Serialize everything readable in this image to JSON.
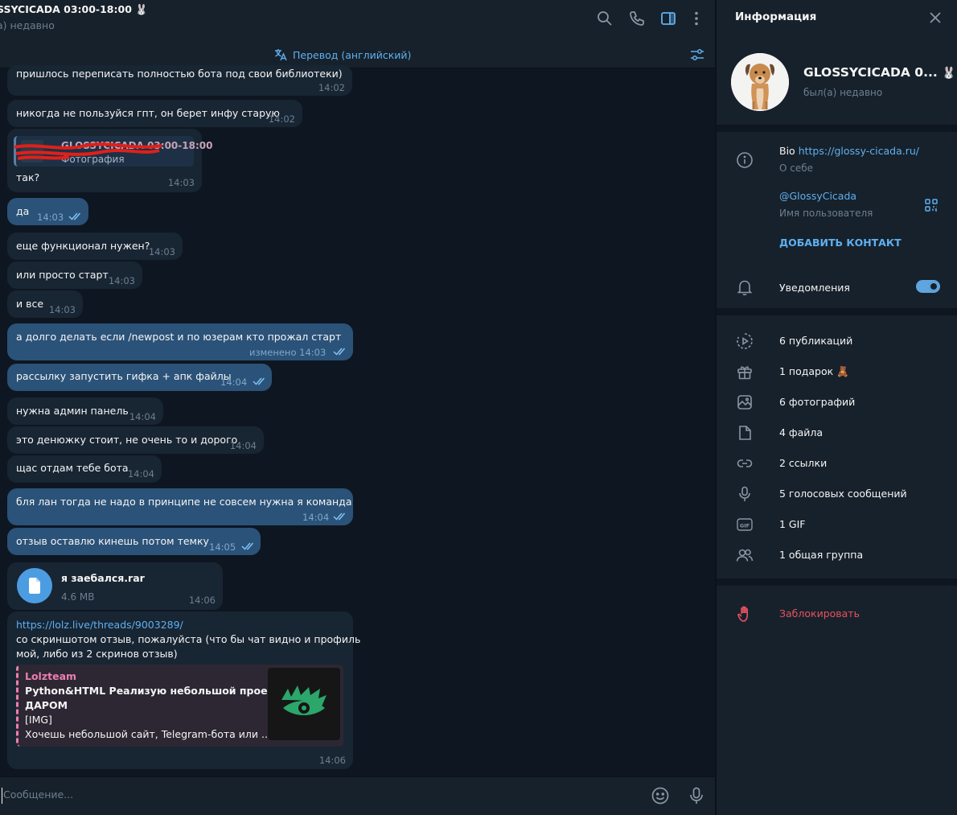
{
  "chat": {
    "title": "SSYCICADA 03:00-18:00",
    "title_emoji": "🐰",
    "status": "а) недавно",
    "translate_label": "Перевод (английский)",
    "messages": [
      {
        "text": "пришлось переписать полностью бота под свои библиотеки)",
        "time": "14:02"
      },
      {
        "text": "никогда не пользуйся гпт, он берет инфу старую",
        "time": "14:02"
      },
      {
        "reply_name": "GLOSSYCICADA 03:00-18:00",
        "reply_text": "Фотография",
        "text": "так?",
        "time": "14:03"
      },
      {
        "text": "да",
        "time": "14:03"
      },
      {
        "text": "еще функционал нужен?",
        "time": "14:03"
      },
      {
        "text": "или просто старт",
        "time": "14:03"
      },
      {
        "text": "и все",
        "time": "14:03"
      },
      {
        "text": "а долго делать если /newpost и по юзерам кто прожал старт",
        "time": "изменено 14:03"
      },
      {
        "text": "рассылку запустить гифка + апк файлы",
        "time": "14:04"
      },
      {
        "text": "нужна админ панель",
        "time": "14:04"
      },
      {
        "text": "это денюжку стоит, не очень то и дорого",
        "time": "14:04"
      },
      {
        "text": "щас отдам тебе бота",
        "time": "14:04"
      },
      {
        "text": "бля лан тогда не надо в принципе не совсем нужна я команда",
        "time": "14:04"
      },
      {
        "text": "отзыв оставлю кинешь потом темку",
        "time": "14:05"
      },
      {
        "file_name": "я заебался.rar",
        "file_size": "4.6 MB",
        "time": "14:06"
      },
      {
        "link": "https://lolz.live/threads/9003289/",
        "text_line1": "со скриншотом отзыв, пожалуйста (что бы чат видно и профиль",
        "text_line2": "мой, либо из 2 скринов отзыв)",
        "preview_site": "Lolzteam",
        "preview_title1": "Python&HTML Реализую небольшой проект",
        "preview_title2": "ДАРОМ",
        "preview_img": "[IMG]",
        "preview_desc": "Хочешь небольшой сайт, Telegram-бота или ...",
        "time": "14:06"
      }
    ],
    "composer_placeholder": "Сообщение..."
  },
  "info": {
    "title": "Информация",
    "name": "GLOSSYCICADA 0...",
    "name_emoji": "🐰",
    "status": "был(а) недавно",
    "bio_label": "Bio",
    "bio_link": "https://glossy-cicada.ru/",
    "bio_sub": "О себе",
    "username": "@GlossyCicada",
    "username_sub": "Имя пользователя",
    "add_contact": "ДОБАВИТЬ КОНТАКТ",
    "notifications": "Уведомления",
    "notifications_on": true,
    "media": [
      {
        "icon": "story-icon",
        "label": "6 публикаций"
      },
      {
        "icon": "gift-icon",
        "label": "1 подарок",
        "emoji": "🧸"
      },
      {
        "icon": "photo-icon",
        "label": "6 фотографий"
      },
      {
        "icon": "file-icon",
        "label": "4 файла"
      },
      {
        "icon": "link-icon",
        "label": "2 ссылки"
      },
      {
        "icon": "mic-icon",
        "label": "5 голосовых сообщений"
      },
      {
        "icon": "gif-icon",
        "label": "1 GIF"
      },
      {
        "icon": "group-icon",
        "label": "1 общая группа"
      }
    ],
    "block": "Заблокировать"
  },
  "colors": {
    "background": "#0e1621",
    "panel": "#17212b",
    "incoming": "#182533",
    "outgoing": "#2b5278",
    "accent": "#5fb0f0",
    "danger": "#e5525e"
  }
}
